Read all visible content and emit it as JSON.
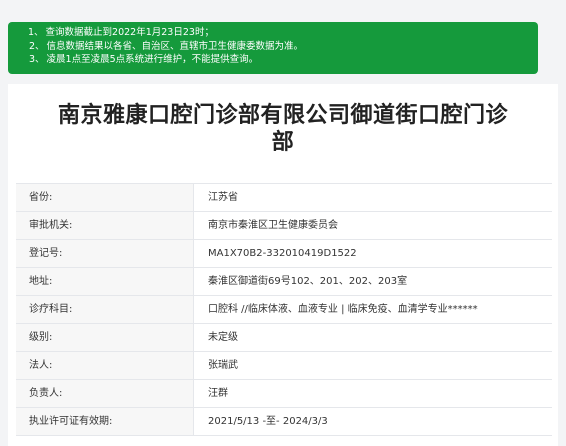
{
  "notice": {
    "items": [
      {
        "num": "1、",
        "text": "查询数据截止到2022年1月23日23时；"
      },
      {
        "num": "2、",
        "text": "信息数据结果以各省、自治区、直辖市卫生健康委数据为准。"
      },
      {
        "num": "3、",
        "text": "凌晨1点至凌晨5点系统进行维护，不能提供查询。"
      }
    ]
  },
  "clinic": {
    "title_line1": "南京雅康口腔门诊部有限公司御道街口腔门诊",
    "title_line2": "部"
  },
  "details": [
    {
      "label": "省份:",
      "value": "江苏省"
    },
    {
      "label": "审批机关:",
      "value": "南京市秦淮区卫生健康委员会"
    },
    {
      "label": "登记号:",
      "value": "MA1X70B2-332010419D1522"
    },
    {
      "label": "地址:",
      "value": "秦淮区御道街69号102、201、202、203室"
    },
    {
      "label": "诊疗科目:",
      "value": "口腔科 //临床体液、血液专业 | 临床免疫、血清学专业******"
    },
    {
      "label": "级别:",
      "value": "未定级"
    },
    {
      "label": "法人:",
      "value": "张瑞武"
    },
    {
      "label": "负责人:",
      "value": "汪群"
    },
    {
      "label": "执业许可证有效期:",
      "value": "2021/5/13 -至- 2024/3/3"
    }
  ]
}
